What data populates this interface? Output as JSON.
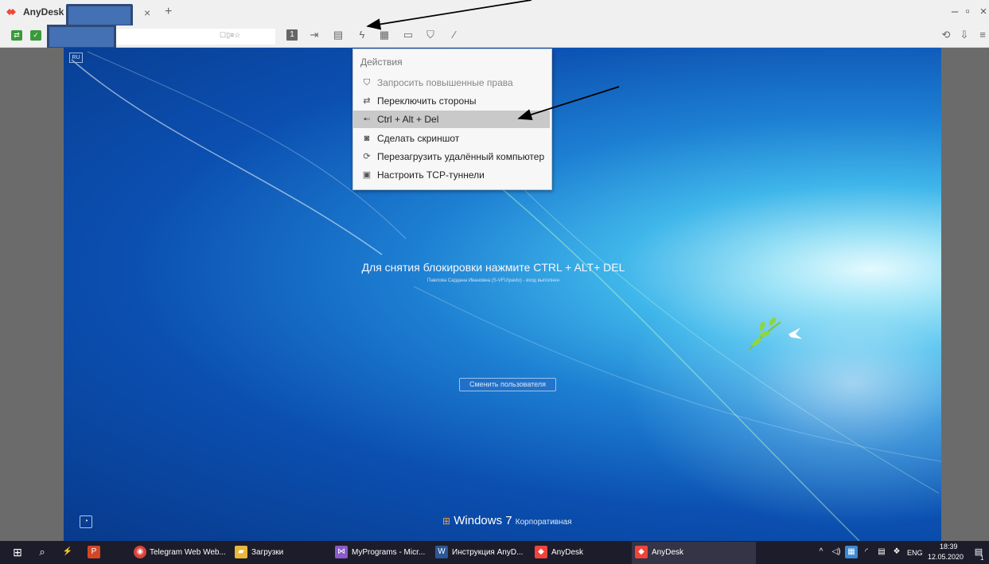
{
  "app": {
    "name": "AnyDesk",
    "brand_color": "#ef443b"
  },
  "tab": {
    "close_glyph": "×",
    "new_glyph": "+"
  },
  "window_controls": {
    "minimize": "–",
    "maximize": "▫",
    "close": "×"
  },
  "remote": {
    "lang_badge": "RU",
    "lock_message": "Для снятия блокировки нажмите CTRL + ALT+ DEL",
    "user_status": "Павлова Сардана Ивановна (S-VFU\\pavlo) - вход выполнен",
    "switch_user": "Сменить пользователя",
    "windows_brand": "Windows",
    "windows_version": "7",
    "windows_edition": "Корпоративная"
  },
  "toolbar": {
    "monitor_number": "1",
    "icons": [
      "display-settings-icon",
      "monitor-1-icon",
      "exit-fullscreen-icon",
      "chat-icon",
      "actions-lightning-icon",
      "keyboard-icon",
      "view-icon",
      "permissions-icon",
      "draw-icon"
    ]
  },
  "actions_menu": {
    "header": "Действия",
    "items": [
      {
        "label": "Запросить повышенные права",
        "icon": "shield-icon",
        "disabled": true
      },
      {
        "label": "Переключить стороны",
        "icon": "switch-sides-icon",
        "disabled": false
      },
      {
        "label": "Ctrl + Alt + Del",
        "icon": "ctrl-alt-del-icon",
        "disabled": false,
        "highlighted": true
      },
      {
        "label": "Сделать скриншот",
        "icon": "camera-icon",
        "disabled": false
      },
      {
        "label": "Перезагрузить удалённый компьютер",
        "icon": "restart-icon",
        "disabled": false
      },
      {
        "label": "Настроить TCP-туннели",
        "icon": "tcp-tunnel-icon",
        "disabled": false
      }
    ]
  },
  "taskbar": {
    "items": [
      {
        "label": "Telegram Web Web..."
      },
      {
        "label": "Загрузки"
      },
      {
        "label": "MyPrograms - Micr..."
      },
      {
        "label": "Инструкция AnyD..."
      },
      {
        "label": "AnyDesk"
      },
      {
        "label": "AnyDesk"
      }
    ],
    "language": "ENG",
    "time": "18:39",
    "date": "12.05.2020",
    "notification_count": "1"
  }
}
